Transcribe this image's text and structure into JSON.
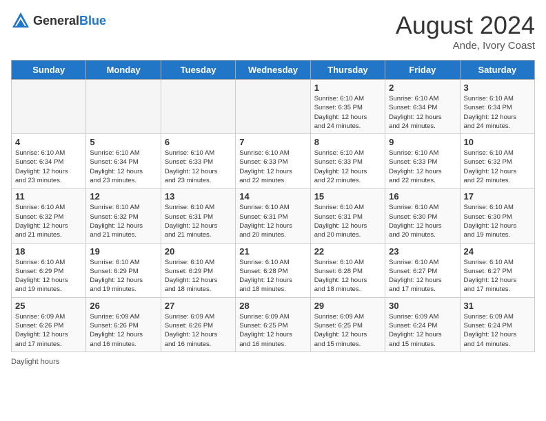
{
  "header": {
    "logo_general": "General",
    "logo_blue": "Blue",
    "month_year": "August 2024",
    "location": "Ande, Ivory Coast"
  },
  "days_of_week": [
    "Sunday",
    "Monday",
    "Tuesday",
    "Wednesday",
    "Thursday",
    "Friday",
    "Saturday"
  ],
  "weeks": [
    [
      {
        "day": "",
        "detail": ""
      },
      {
        "day": "",
        "detail": ""
      },
      {
        "day": "",
        "detail": ""
      },
      {
        "day": "",
        "detail": ""
      },
      {
        "day": "1",
        "detail": "Sunrise: 6:10 AM\nSunset: 6:35 PM\nDaylight: 12 hours\nand 24 minutes."
      },
      {
        "day": "2",
        "detail": "Sunrise: 6:10 AM\nSunset: 6:34 PM\nDaylight: 12 hours\nand 24 minutes."
      },
      {
        "day": "3",
        "detail": "Sunrise: 6:10 AM\nSunset: 6:34 PM\nDaylight: 12 hours\nand 24 minutes."
      }
    ],
    [
      {
        "day": "4",
        "detail": "Sunrise: 6:10 AM\nSunset: 6:34 PM\nDaylight: 12 hours\nand 23 minutes."
      },
      {
        "day": "5",
        "detail": "Sunrise: 6:10 AM\nSunset: 6:34 PM\nDaylight: 12 hours\nand 23 minutes."
      },
      {
        "day": "6",
        "detail": "Sunrise: 6:10 AM\nSunset: 6:33 PM\nDaylight: 12 hours\nand 23 minutes."
      },
      {
        "day": "7",
        "detail": "Sunrise: 6:10 AM\nSunset: 6:33 PM\nDaylight: 12 hours\nand 22 minutes."
      },
      {
        "day": "8",
        "detail": "Sunrise: 6:10 AM\nSunset: 6:33 PM\nDaylight: 12 hours\nand 22 minutes."
      },
      {
        "day": "9",
        "detail": "Sunrise: 6:10 AM\nSunset: 6:33 PM\nDaylight: 12 hours\nand 22 minutes."
      },
      {
        "day": "10",
        "detail": "Sunrise: 6:10 AM\nSunset: 6:32 PM\nDaylight: 12 hours\nand 22 minutes."
      }
    ],
    [
      {
        "day": "11",
        "detail": "Sunrise: 6:10 AM\nSunset: 6:32 PM\nDaylight: 12 hours\nand 21 minutes."
      },
      {
        "day": "12",
        "detail": "Sunrise: 6:10 AM\nSunset: 6:32 PM\nDaylight: 12 hours\nand 21 minutes."
      },
      {
        "day": "13",
        "detail": "Sunrise: 6:10 AM\nSunset: 6:31 PM\nDaylight: 12 hours\nand 21 minutes."
      },
      {
        "day": "14",
        "detail": "Sunrise: 6:10 AM\nSunset: 6:31 PM\nDaylight: 12 hours\nand 20 minutes."
      },
      {
        "day": "15",
        "detail": "Sunrise: 6:10 AM\nSunset: 6:31 PM\nDaylight: 12 hours\nand 20 minutes."
      },
      {
        "day": "16",
        "detail": "Sunrise: 6:10 AM\nSunset: 6:30 PM\nDaylight: 12 hours\nand 20 minutes."
      },
      {
        "day": "17",
        "detail": "Sunrise: 6:10 AM\nSunset: 6:30 PM\nDaylight: 12 hours\nand 19 minutes."
      }
    ],
    [
      {
        "day": "18",
        "detail": "Sunrise: 6:10 AM\nSunset: 6:29 PM\nDaylight: 12 hours\nand 19 minutes."
      },
      {
        "day": "19",
        "detail": "Sunrise: 6:10 AM\nSunset: 6:29 PM\nDaylight: 12 hours\nand 19 minutes."
      },
      {
        "day": "20",
        "detail": "Sunrise: 6:10 AM\nSunset: 6:29 PM\nDaylight: 12 hours\nand 18 minutes."
      },
      {
        "day": "21",
        "detail": "Sunrise: 6:10 AM\nSunset: 6:28 PM\nDaylight: 12 hours\nand 18 minutes."
      },
      {
        "day": "22",
        "detail": "Sunrise: 6:10 AM\nSunset: 6:28 PM\nDaylight: 12 hours\nand 18 minutes."
      },
      {
        "day": "23",
        "detail": "Sunrise: 6:10 AM\nSunset: 6:27 PM\nDaylight: 12 hours\nand 17 minutes."
      },
      {
        "day": "24",
        "detail": "Sunrise: 6:10 AM\nSunset: 6:27 PM\nDaylight: 12 hours\nand 17 minutes."
      }
    ],
    [
      {
        "day": "25",
        "detail": "Sunrise: 6:09 AM\nSunset: 6:26 PM\nDaylight: 12 hours\nand 17 minutes."
      },
      {
        "day": "26",
        "detail": "Sunrise: 6:09 AM\nSunset: 6:26 PM\nDaylight: 12 hours\nand 16 minutes."
      },
      {
        "day": "27",
        "detail": "Sunrise: 6:09 AM\nSunset: 6:26 PM\nDaylight: 12 hours\nand 16 minutes."
      },
      {
        "day": "28",
        "detail": "Sunrise: 6:09 AM\nSunset: 6:25 PM\nDaylight: 12 hours\nand 16 minutes."
      },
      {
        "day": "29",
        "detail": "Sunrise: 6:09 AM\nSunset: 6:25 PM\nDaylight: 12 hours\nand 15 minutes."
      },
      {
        "day": "30",
        "detail": "Sunrise: 6:09 AM\nSunset: 6:24 PM\nDaylight: 12 hours\nand 15 minutes."
      },
      {
        "day": "31",
        "detail": "Sunrise: 6:09 AM\nSunset: 6:24 PM\nDaylight: 12 hours\nand 14 minutes."
      }
    ]
  ],
  "footer": {
    "daylight_label": "Daylight hours"
  }
}
